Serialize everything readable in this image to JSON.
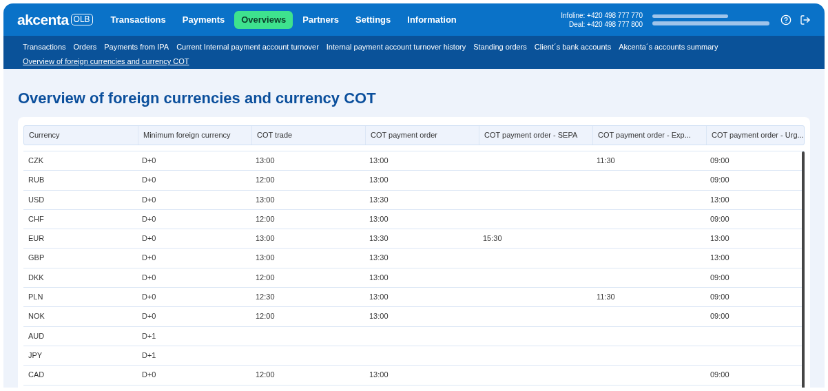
{
  "header": {
    "logo": "akcenta",
    "logo_badge": "OLB",
    "nav": [
      {
        "label": "Transactions",
        "selected": false
      },
      {
        "label": "Payments",
        "selected": false
      },
      {
        "label": "Overviews",
        "selected": true
      },
      {
        "label": "Partners",
        "selected": false
      },
      {
        "label": "Settings",
        "selected": false
      },
      {
        "label": "Information",
        "selected": false
      }
    ],
    "contacts": [
      "Infoline: +420 498 777 770",
      "Deal: +420 498 777 800"
    ]
  },
  "subnav": [
    {
      "label": "Transactions",
      "selected": false
    },
    {
      "label": "Orders",
      "selected": false
    },
    {
      "label": "Payments from IPA",
      "selected": false
    },
    {
      "label": "Current Internal payment account turnover",
      "selected": false
    },
    {
      "label": "Internal payment account turnover history",
      "selected": false
    },
    {
      "label": "Standing orders",
      "selected": false
    },
    {
      "label": "Client´s bank accounts",
      "selected": false
    },
    {
      "label": "Akcenta´s accounts summary",
      "selected": false
    },
    {
      "label": "Overview of foreign currencies and currency COT",
      "selected": true
    }
  ],
  "page_title": "Overview of foreign currencies and currency COT",
  "table": {
    "columns": [
      "Currency",
      "Minimum foreign currency",
      "COT trade",
      "COT payment order",
      "COT payment order - SEPA",
      "COT payment order - Exp...",
      "COT payment order - Urg..."
    ],
    "rows": [
      [
        "CZK",
        "D+0",
        "13:00",
        "13:00",
        "",
        "11:30",
        "09:00"
      ],
      [
        "RUB",
        "D+0",
        "12:00",
        "13:00",
        "",
        "",
        "09:00"
      ],
      [
        "USD",
        "D+0",
        "13:00",
        "13:30",
        "",
        "",
        "13:00"
      ],
      [
        "CHF",
        "D+0",
        "12:00",
        "13:00",
        "",
        "",
        "09:00"
      ],
      [
        "EUR",
        "D+0",
        "13:00",
        "13:30",
        "15:30",
        "",
        "13:00"
      ],
      [
        "GBP",
        "D+0",
        "13:00",
        "13:30",
        "",
        "",
        "13:00"
      ],
      [
        "DKK",
        "D+0",
        "12:00",
        "13:00",
        "",
        "",
        "09:00"
      ],
      [
        "PLN",
        "D+0",
        "12:30",
        "13:00",
        "",
        "11:30",
        "09:00"
      ],
      [
        "NOK",
        "D+0",
        "12:00",
        "13:00",
        "",
        "",
        "09:00"
      ],
      [
        "AUD",
        "D+1",
        "",
        "",
        "",
        "",
        ""
      ],
      [
        "JPY",
        "D+1",
        "",
        "",
        "",
        "",
        ""
      ],
      [
        "CAD",
        "D+0",
        "12:00",
        "13:00",
        "",
        "",
        "09:00"
      ]
    ]
  }
}
